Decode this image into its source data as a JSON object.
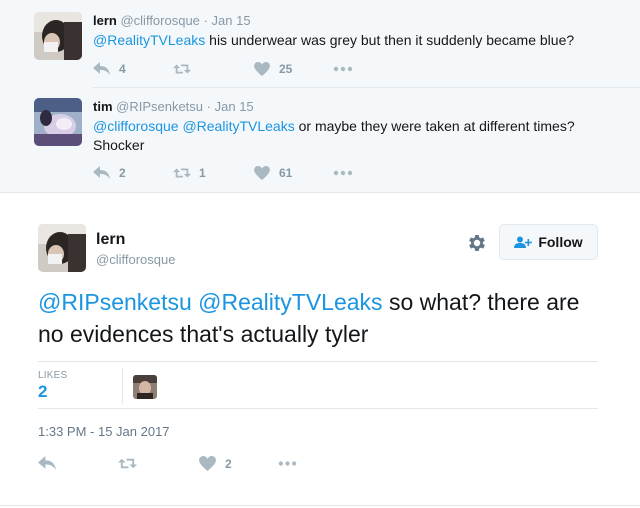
{
  "replies": [
    {
      "name": "lern",
      "handle": "@clifforosque",
      "dot": "·",
      "time": "Jan 15",
      "mention1": "@RealityTVLeaks",
      "mention2": "",
      "text": " his underwear was grey but then it suddenly became blue?",
      "text2": "",
      "reply_count": "4",
      "retweet_count": "",
      "like_count": "25"
    },
    {
      "name": "tim",
      "handle": "@RIPsenketsu",
      "dot": "·",
      "time": "Jan 15",
      "mention1": "@clifforosque",
      "mention2": "@RealityTVLeaks",
      "text": " or maybe they were taken at different times?",
      "text2": "Shocker",
      "reply_count": "2",
      "retweet_count": "1",
      "like_count": "61"
    }
  ],
  "main": {
    "name": "lern",
    "handle": "@clifforosque",
    "follow_label": "Follow",
    "mention1": "@RIPsenketsu",
    "mention2": "@RealityTVLeaks",
    "text": " so what? there are no evidences that's actually tyler",
    "likes_label": "LIKES",
    "likes_count": "2",
    "timestamp": "1:33 PM - 15 Jan 2017",
    "like_count": "2"
  },
  "icons": {
    "reply": "reply-icon",
    "retweet": "retweet-icon",
    "like": "heart-icon",
    "more": "more-icon",
    "gear": "gear-icon",
    "follow": "add-user-icon"
  },
  "colors": {
    "link": "#1b95e0",
    "muted": "#8899a6",
    "icon": "#aab8c2",
    "reply_bg": "#f5f8fa"
  }
}
